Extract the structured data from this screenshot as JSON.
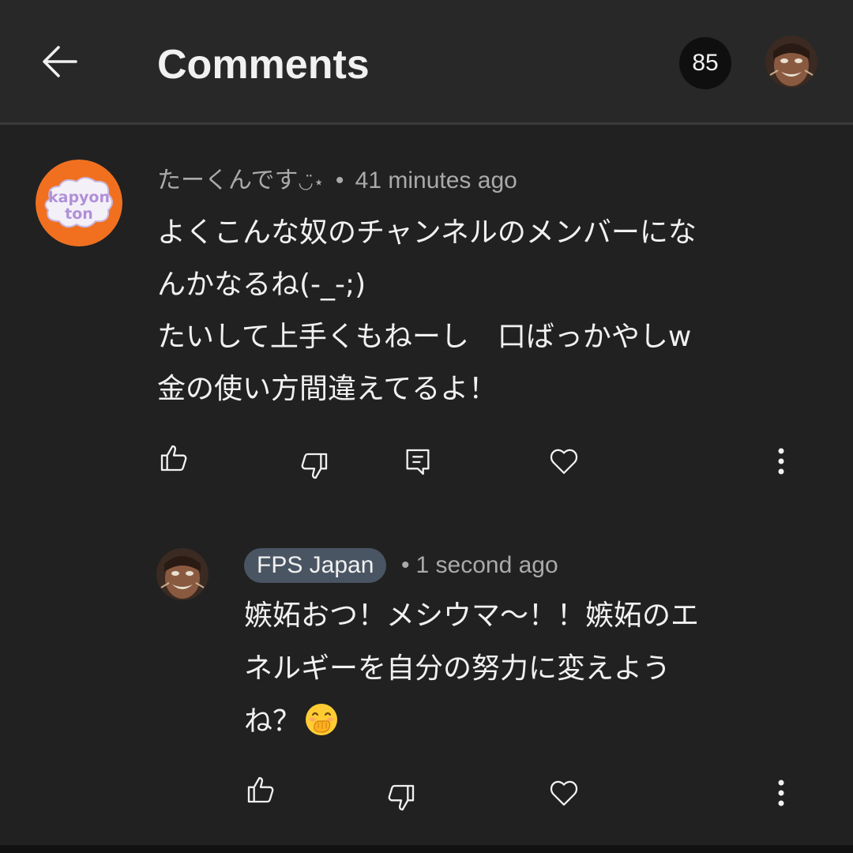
{
  "header": {
    "title": "Comments",
    "comment_count": "85",
    "back_icon": "arrow-left-icon",
    "user_avatar_icon": "user-avatar"
  },
  "comment": {
    "author": "たーくんです",
    "author_suffix": "◡̈⋆",
    "separator": "•",
    "time": "41 minutes ago",
    "avatar_text_line1": "kapyon",
    "avatar_text_line2": "ton",
    "avatar_color": "#f07020",
    "lines": [
      "よくこんな奴のチャンネルのメンバーにな",
      "んかなるね(-_-;)",
      "たいして上手くもねーし　口ばっかやしw",
      "金の使い方間違えてるよ！"
    ],
    "actions": [
      "thumbs-up-icon",
      "thumbs-down-icon",
      "reply-icon",
      "heart-icon",
      "more-vert-icon"
    ]
  },
  "reply": {
    "author": "FPS Japan",
    "author_chip_color": "#4a5563",
    "separator": "•",
    "time": "1 second ago",
    "lines": [
      "嫉妬おつ！メシウマ〜！！嫉妬のエ",
      "ネルギーを自分の努力に変えよう",
      "ね？"
    ],
    "emoji": "face-with-hand-over-mouth-icon",
    "actions": [
      "thumbs-up-icon",
      "thumbs-down-icon",
      "heart-icon",
      "more-vert-icon"
    ]
  }
}
